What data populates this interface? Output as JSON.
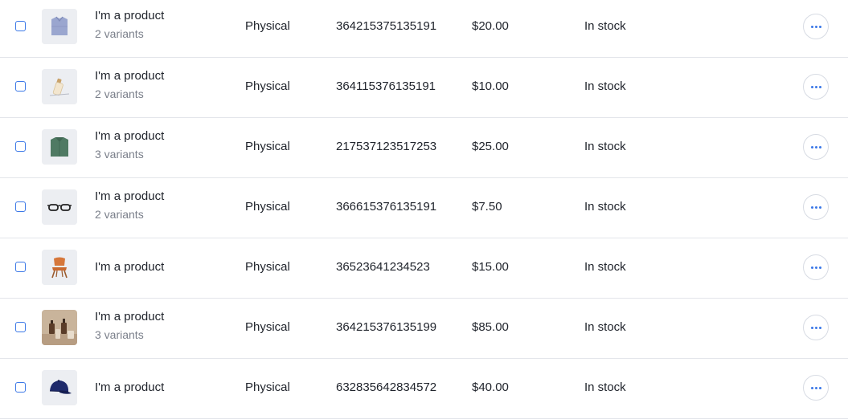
{
  "products": [
    {
      "name": "I'm a product",
      "variants": "2 variants",
      "type": "Physical",
      "sku": "364215375135191",
      "price": "$20.00",
      "stock": "In stock",
      "image": "folded-shirt-image"
    },
    {
      "name": "I'm a product",
      "variants": "2 variants",
      "type": "Physical",
      "sku": "364115376135191",
      "price": "$10.00",
      "stock": "In stock",
      "image": "bottle-image"
    },
    {
      "name": "I'm a product",
      "variants": "3 variants",
      "type": "Physical",
      "sku": "217537123517253",
      "price": "$25.00",
      "stock": "In stock",
      "image": "green-sweater-image"
    },
    {
      "name": "I'm a product",
      "variants": "2 variants",
      "type": "Physical",
      "sku": "366615376135191",
      "price": "$7.50",
      "stock": "In stock",
      "image": "glasses-image"
    },
    {
      "name": "I'm a product",
      "variants": "",
      "type": "Physical",
      "sku": "36523641234523",
      "price": "$15.00",
      "stock": "In stock",
      "image": "chair-image"
    },
    {
      "name": "I'm a product",
      "variants": "3 variants",
      "type": "Physical",
      "sku": "364215376135199",
      "price": "$85.00",
      "stock": "In stock",
      "image": "cosmetics-image"
    },
    {
      "name": "I'm a product",
      "variants": "",
      "type": "Physical",
      "sku": "632835642834572",
      "price": "$40.00",
      "stock": "In stock",
      "image": "cap-image"
    }
  ],
  "colors": {
    "accent": "#3b78e7",
    "divider": "#e3e5ea",
    "muted_text": "#7a7f8a"
  },
  "icons": {
    "more_actions": "more-horizontal-icon"
  }
}
